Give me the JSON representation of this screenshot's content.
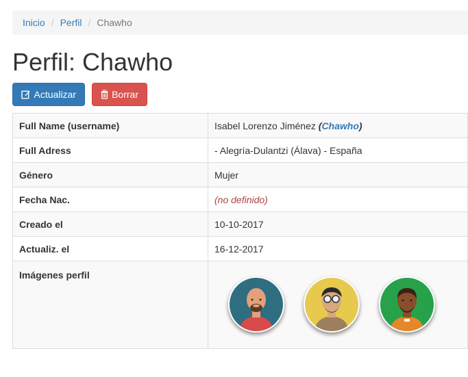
{
  "breadcrumb": {
    "home": "Inicio",
    "profile": "Perfil",
    "current": "Chawho",
    "separator": "/"
  },
  "title": "Perfil: Chawho",
  "buttons": {
    "update": "Actualizar",
    "delete": "Borrar"
  },
  "details": {
    "full_name": {
      "label": "Full Name (username)",
      "name": "Isabel Lorenzo Jiménez",
      "open": "(",
      "username": "Chawho",
      "close": ")"
    },
    "full_address": {
      "label": "Full Adress",
      "value": "- Alegría-Dulantzi (Álava) - España"
    },
    "gender": {
      "label": "Género",
      "value": "Mujer"
    },
    "birth_date": {
      "label": "Fecha Nac.",
      "value": "(no definido)"
    },
    "created": {
      "label": "Creado el",
      "value": "10-10-2017"
    },
    "updated": {
      "label": "Actualiz. el",
      "value": "16-12-2017"
    },
    "images": {
      "label": "Imágenes perfil"
    }
  },
  "colors": {
    "primary": "#337ab7",
    "danger": "#d9534f",
    "undefined_text": "#a94442"
  },
  "avatars": [
    {
      "name": "bald-man-avatar-icon",
      "bg": "#2f6e80"
    },
    {
      "name": "sunglasses-man-avatar-icon",
      "bg": "#e7c94d"
    },
    {
      "name": "dark-skin-man-avatar-icon",
      "bg": "#27a24a"
    }
  ]
}
